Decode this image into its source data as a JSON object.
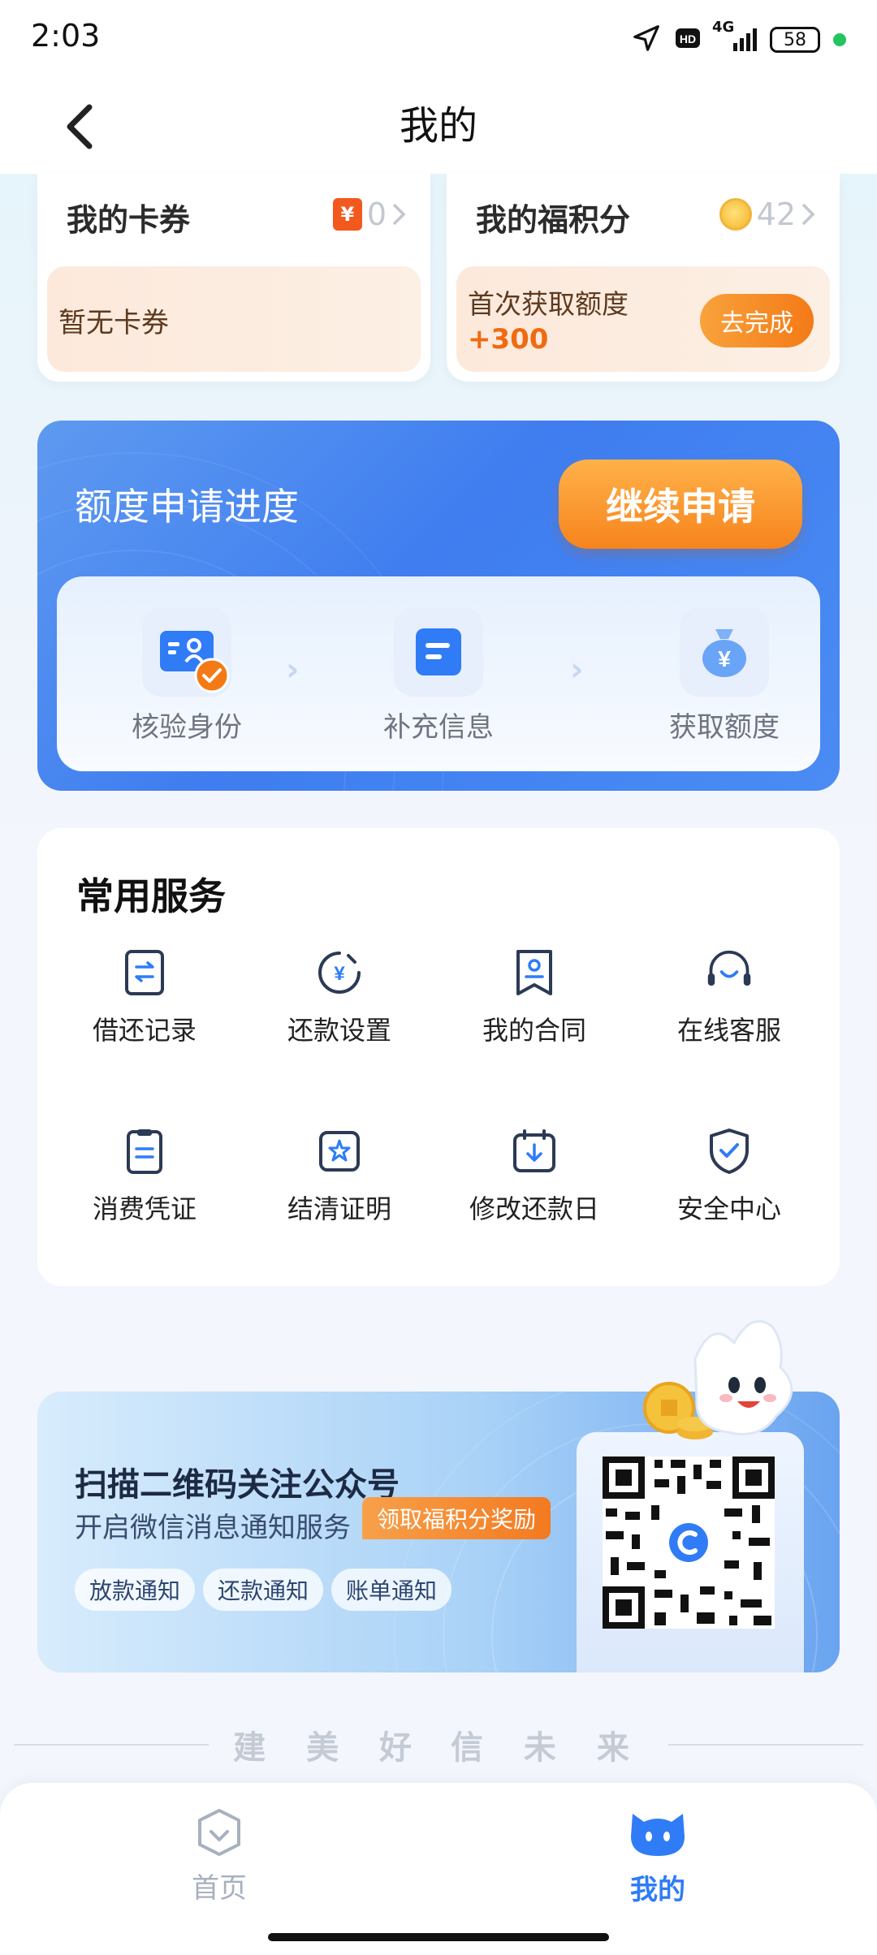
{
  "status": {
    "time": "2:03",
    "battery": "58",
    "network": "4G"
  },
  "header": {
    "title": "我的"
  },
  "cards": {
    "coupons": {
      "title": "我的卡券",
      "count": "0",
      "empty_text": "暂无卡券",
      "icon": "coupon-icon"
    },
    "points": {
      "title": "我的福积分",
      "count": "42",
      "first_label": "首次获取额度",
      "bonus": "+300",
      "button": "去完成",
      "icon": "coin-icon"
    }
  },
  "progress": {
    "title": "额度申请进度",
    "continue_button": "继续申请",
    "steps": [
      {
        "label": "核验身份",
        "icon": "id-card-check-icon",
        "done": true
      },
      {
        "label": "补充信息",
        "icon": "document-icon",
        "done": false
      },
      {
        "label": "获取额度",
        "icon": "money-bag-icon",
        "done": false
      }
    ]
  },
  "services": {
    "title": "常用服务",
    "items": [
      {
        "label": "借还记录",
        "icon": "record-icon"
      },
      {
        "label": "还款设置",
        "icon": "repay-settings-icon"
      },
      {
        "label": "我的合同",
        "icon": "contract-icon"
      },
      {
        "label": "在线客服",
        "icon": "headset-icon"
      },
      {
        "label": "消费凭证",
        "icon": "receipt-icon"
      },
      {
        "label": "结清证明",
        "icon": "certificate-icon"
      },
      {
        "label": "修改还款日",
        "icon": "calendar-icon"
      },
      {
        "label": "安全中心",
        "icon": "shield-icon"
      }
    ]
  },
  "banner": {
    "title": "扫描二维码关注公众号",
    "subtitle": "开启微信消息通知服务",
    "reward_tag": "领取福积分奖励",
    "chips": [
      "放款通知",
      "还款通知",
      "账单通知"
    ]
  },
  "slogan": {
    "left": "建 美 好",
    "right": "信 未 来"
  },
  "tabbar": {
    "home": "首页",
    "mine": "我的",
    "active_color": "#2f7cf6",
    "inactive_color": "#a7b0be"
  }
}
